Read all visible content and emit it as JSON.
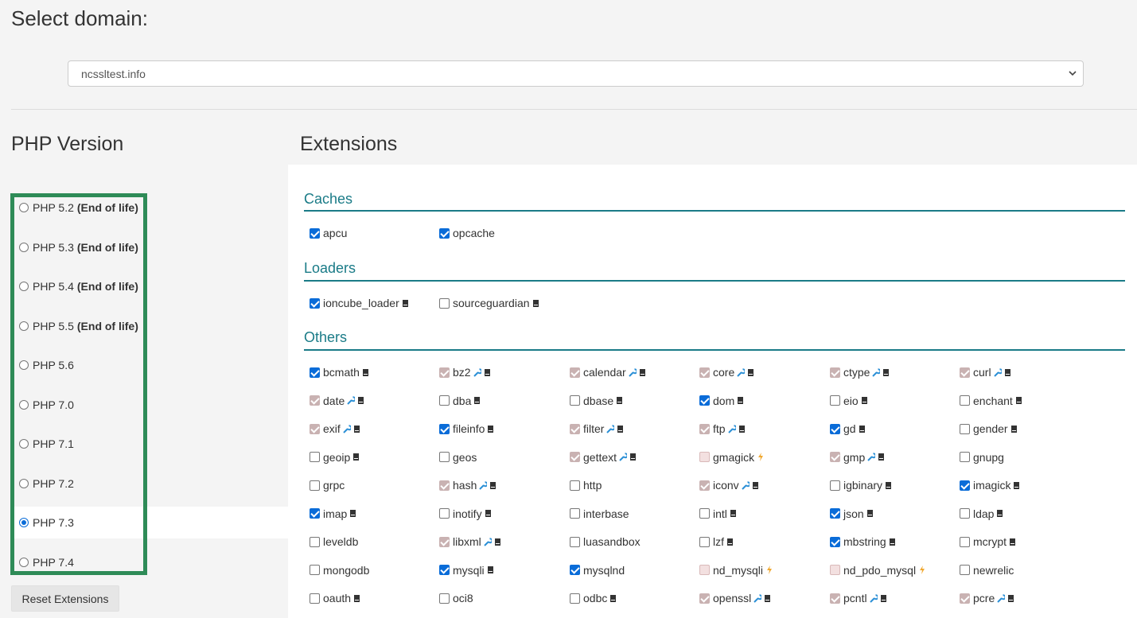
{
  "domain": {
    "title": "Select domain:",
    "selected": "ncssltest.info"
  },
  "php": {
    "title": "PHP Version",
    "versions": [
      {
        "label": "PHP 5.2",
        "badge": "(End of life)",
        "selected": false
      },
      {
        "label": "PHP 5.3",
        "badge": "(End of life)",
        "selected": false
      },
      {
        "label": "PHP 5.4",
        "badge": "(End of life)",
        "selected": false
      },
      {
        "label": "PHP 5.5",
        "badge": "(End of life)",
        "selected": false
      },
      {
        "label": "PHP 5.6",
        "badge": "",
        "selected": false
      },
      {
        "label": "PHP 7.0",
        "badge": "",
        "selected": false
      },
      {
        "label": "PHP 7.1",
        "badge": "",
        "selected": false
      },
      {
        "label": "PHP 7.2",
        "badge": "",
        "selected": false
      },
      {
        "label": "PHP 7.3",
        "badge": "",
        "selected": true
      },
      {
        "label": "PHP 7.4",
        "badge": "",
        "selected": false
      }
    ],
    "reset_label": "Reset Extensions"
  },
  "extensions": {
    "title": "Extensions",
    "icons": {
      "wrench": "wrench-icon",
      "doc": "doc-icon",
      "lightning": "lightning-icon"
    },
    "colors": {
      "accent": "#1a7b87",
      "highlight": "#2e8b57",
      "checked": "#0a6cd8",
      "locked": "#c9b2b2",
      "wrench": "#2a8fd6",
      "lightning": "#f0a830"
    },
    "groups": [
      {
        "title": "Caches",
        "items": [
          {
            "name": "apcu",
            "state": "checked",
            "icons": []
          },
          {
            "name": "opcache",
            "state": "checked",
            "icons": []
          }
        ]
      },
      {
        "title": "Loaders",
        "items": [
          {
            "name": "ioncube_loader",
            "state": "checked",
            "icons": [
              "doc"
            ]
          },
          {
            "name": "sourceguardian",
            "state": "unchecked",
            "icons": [
              "doc"
            ]
          }
        ]
      },
      {
        "title": "Others",
        "items": [
          {
            "name": "bcmath",
            "state": "checked",
            "icons": [
              "doc"
            ]
          },
          {
            "name": "bz2",
            "state": "locked",
            "icons": [
              "wrench",
              "doc"
            ]
          },
          {
            "name": "calendar",
            "state": "locked",
            "icons": [
              "wrench",
              "doc"
            ]
          },
          {
            "name": "core",
            "state": "locked",
            "icons": [
              "wrench",
              "doc"
            ]
          },
          {
            "name": "ctype",
            "state": "locked",
            "icons": [
              "wrench",
              "doc"
            ]
          },
          {
            "name": "curl",
            "state": "locked",
            "icons": [
              "wrench",
              "doc"
            ]
          },
          {
            "name": "date",
            "state": "locked",
            "icons": [
              "wrench",
              "doc"
            ]
          },
          {
            "name": "dba",
            "state": "unchecked",
            "icons": [
              "doc"
            ]
          },
          {
            "name": "dbase",
            "state": "unchecked",
            "icons": [
              "doc"
            ]
          },
          {
            "name": "dom",
            "state": "checked",
            "icons": [
              "doc"
            ]
          },
          {
            "name": "eio",
            "state": "unchecked",
            "icons": [
              "doc"
            ]
          },
          {
            "name": "enchant",
            "state": "unchecked",
            "icons": [
              "doc"
            ]
          },
          {
            "name": "exif",
            "state": "locked",
            "icons": [
              "wrench",
              "doc"
            ]
          },
          {
            "name": "fileinfo",
            "state": "checked",
            "icons": [
              "doc"
            ]
          },
          {
            "name": "filter",
            "state": "locked",
            "icons": [
              "wrench",
              "doc"
            ]
          },
          {
            "name": "ftp",
            "state": "locked",
            "icons": [
              "wrench",
              "doc"
            ]
          },
          {
            "name": "gd",
            "state": "checked",
            "icons": [
              "doc"
            ]
          },
          {
            "name": "gender",
            "state": "unchecked",
            "icons": [
              "doc"
            ]
          },
          {
            "name": "geoip",
            "state": "unchecked",
            "icons": [
              "doc"
            ]
          },
          {
            "name": "geos",
            "state": "unchecked",
            "icons": []
          },
          {
            "name": "gettext",
            "state": "locked",
            "icons": [
              "wrench",
              "doc"
            ]
          },
          {
            "name": "gmagick",
            "state": "disabled",
            "icons": [
              "lightning"
            ]
          },
          {
            "name": "gmp",
            "state": "locked",
            "icons": [
              "wrench",
              "doc"
            ]
          },
          {
            "name": "gnupg",
            "state": "unchecked",
            "icons": []
          },
          {
            "name": "grpc",
            "state": "unchecked",
            "icons": []
          },
          {
            "name": "hash",
            "state": "locked",
            "icons": [
              "wrench",
              "doc"
            ]
          },
          {
            "name": "http",
            "state": "unchecked",
            "icons": []
          },
          {
            "name": "iconv",
            "state": "locked",
            "icons": [
              "wrench",
              "doc"
            ]
          },
          {
            "name": "igbinary",
            "state": "unchecked",
            "icons": [
              "doc"
            ]
          },
          {
            "name": "imagick",
            "state": "checked",
            "icons": [
              "doc"
            ]
          },
          {
            "name": "imap",
            "state": "checked",
            "icons": [
              "doc"
            ]
          },
          {
            "name": "inotify",
            "state": "unchecked",
            "icons": [
              "doc"
            ]
          },
          {
            "name": "interbase",
            "state": "unchecked",
            "icons": []
          },
          {
            "name": "intl",
            "state": "unchecked",
            "icons": [
              "doc"
            ]
          },
          {
            "name": "json",
            "state": "checked",
            "icons": [
              "doc"
            ]
          },
          {
            "name": "ldap",
            "state": "unchecked",
            "icons": [
              "doc"
            ]
          },
          {
            "name": "leveldb",
            "state": "unchecked",
            "icons": []
          },
          {
            "name": "libxml",
            "state": "locked",
            "icons": [
              "wrench",
              "doc"
            ]
          },
          {
            "name": "luasandbox",
            "state": "unchecked",
            "icons": []
          },
          {
            "name": "lzf",
            "state": "unchecked",
            "icons": [
              "doc"
            ]
          },
          {
            "name": "mbstring",
            "state": "checked",
            "icons": [
              "doc"
            ]
          },
          {
            "name": "mcrypt",
            "state": "unchecked",
            "icons": [
              "doc"
            ]
          },
          {
            "name": "mongodb",
            "state": "unchecked",
            "icons": []
          },
          {
            "name": "mysqli",
            "state": "checked",
            "icons": [
              "doc"
            ]
          },
          {
            "name": "mysqlnd",
            "state": "checked",
            "icons": []
          },
          {
            "name": "nd_mysqli",
            "state": "disabled",
            "icons": [
              "lightning"
            ]
          },
          {
            "name": "nd_pdo_mysql",
            "state": "disabled",
            "icons": [
              "lightning"
            ]
          },
          {
            "name": "newrelic",
            "state": "unchecked",
            "icons": []
          },
          {
            "name": "oauth",
            "state": "unchecked",
            "icons": [
              "doc"
            ]
          },
          {
            "name": "oci8",
            "state": "unchecked",
            "icons": []
          },
          {
            "name": "odbc",
            "state": "unchecked",
            "icons": [
              "doc"
            ]
          },
          {
            "name": "openssl",
            "state": "locked",
            "icons": [
              "wrench",
              "doc"
            ]
          },
          {
            "name": "pcntl",
            "state": "locked",
            "icons": [
              "wrench",
              "doc"
            ]
          },
          {
            "name": "pcre",
            "state": "locked",
            "icons": [
              "wrench",
              "doc"
            ]
          }
        ]
      }
    ]
  }
}
